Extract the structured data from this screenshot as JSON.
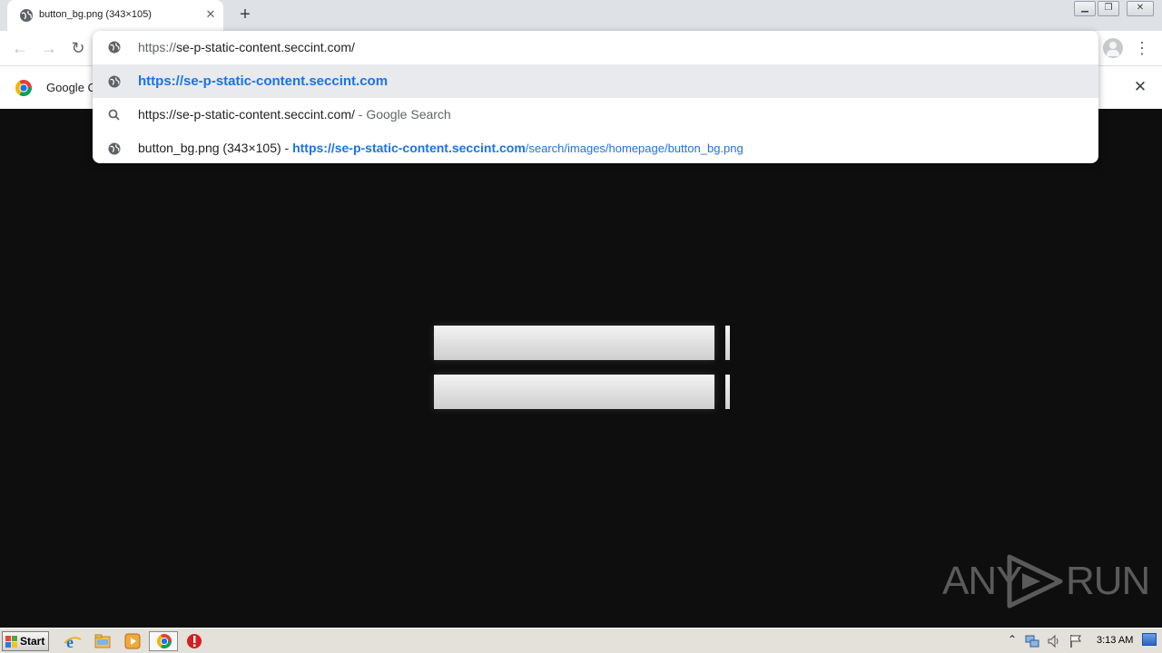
{
  "tab": {
    "title": "button_bg.png (343×105)",
    "close_icon": "close-icon",
    "favicon": "globe-icon"
  },
  "window_controls": {
    "minimize": "minimize-icon",
    "restore": "restore-icon",
    "close": "close-icon"
  },
  "toolbar": {
    "back_icon": "arrow-left-icon",
    "forward_icon": "arrow-right-icon",
    "reload_icon": "reload-icon",
    "profile_icon": "avatar-icon",
    "menu_icon": "kebab-menu-icon"
  },
  "omnibox": {
    "input": {
      "scheme": "https://",
      "host": "se-p-static-content.seccint.com/"
    },
    "suggestions": [
      {
        "icon": "globe-icon",
        "url": "https://se-p-static-content.seccint.com",
        "selected": true
      },
      {
        "icon": "search-icon",
        "query": "https://se-p-static-content.seccint.com/",
        "suffix": " - Google Search"
      },
      {
        "icon": "globe-icon",
        "title": "button_bg.png (343×105) - ",
        "url_host": "https://se-p-static-content.seccint.com",
        "url_path": "/search/images/homepage/button_bg.png"
      }
    ]
  },
  "infobar": {
    "text": "Google Chrome isn't your default browser",
    "visible_text": "Google Cl",
    "close_icon": "close-icon"
  },
  "watermark": {
    "left": "ANY",
    "right": "RUN"
  },
  "taskbar": {
    "start_label": "Start",
    "pinned": [
      "internet-explorer-icon",
      "file-explorer-icon",
      "media-player-icon",
      "chrome-icon",
      "stop-icon"
    ],
    "clock": "3:13 AM"
  },
  "colors": {
    "accent_blue": "#1a73e8",
    "page_bg": "#0e0e0e",
    "tab_strip": "#dee1e6"
  }
}
